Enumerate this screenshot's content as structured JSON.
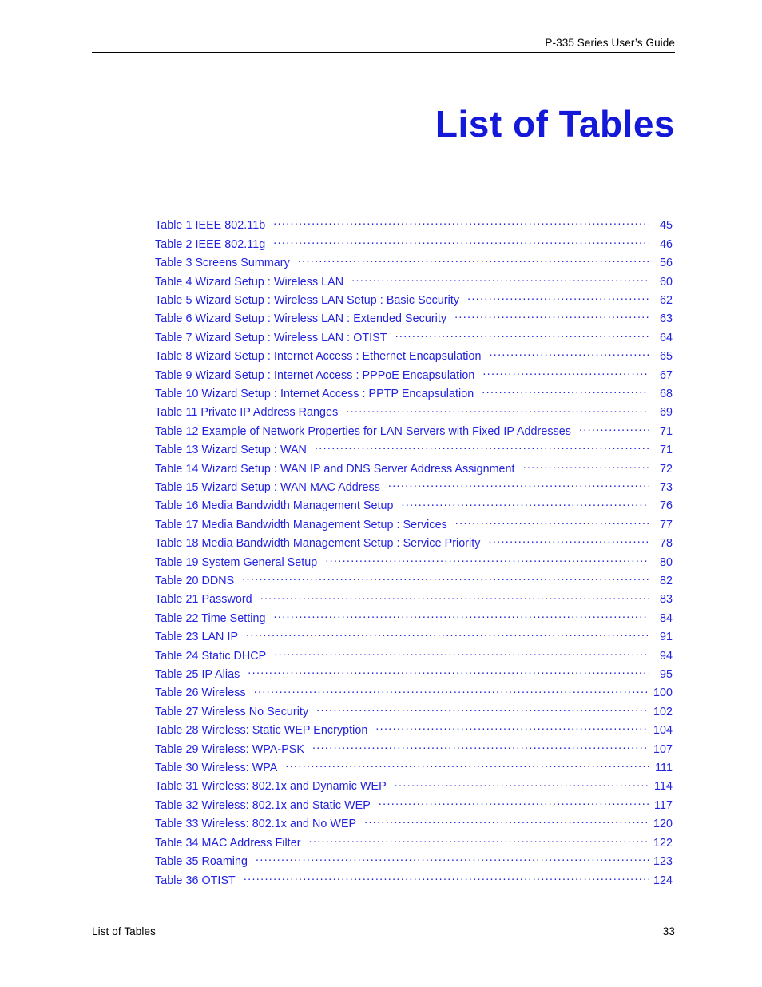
{
  "header": {
    "running_title": "P-335 Series User’s Guide"
  },
  "title": "List of Tables",
  "footer": {
    "section_label": "List of Tables",
    "page_number": "33"
  },
  "colors": {
    "heading_blue": "#1418d8",
    "entry_blue": "#2222e0",
    "rule_black": "#000000",
    "page_background": "#ffffff"
  },
  "toc": {
    "entries": [
      {
        "label": "Table 1 IEEE 802.11b",
        "page": "45"
      },
      {
        "label": "Table 2 IEEE 802.11g",
        "page": "46"
      },
      {
        "label": "Table 3 Screens Summary",
        "page": "56"
      },
      {
        "label": "Table 4 Wizard Setup : Wireless LAN",
        "page": "60"
      },
      {
        "label": "Table 5 Wizard Setup : Wireless LAN Setup : Basic Security",
        "page": "62"
      },
      {
        "label": "Table 6 Wizard Setup : Wireless LAN : Extended Security",
        "page": "63"
      },
      {
        "label": "Table 7 Wizard Setup : Wireless LAN : OTIST",
        "page": "64"
      },
      {
        "label": "Table 8 Wizard Setup : Internet Access : Ethernet Encapsulation",
        "page": "65"
      },
      {
        "label": "Table 9 Wizard Setup : Internet Access : PPPoE Encapsulation",
        "page": "67"
      },
      {
        "label": "Table 10 Wizard Setup : Internet Access : PPTP Encapsulation",
        "page": "68"
      },
      {
        "label": "Table 11 Private IP Address Ranges",
        "page": "69"
      },
      {
        "label": "Table 12 Example of Network Properties for LAN Servers with Fixed IP Addresses",
        "page": "71"
      },
      {
        "label": "Table 13 Wizard Setup : WAN",
        "page": "71"
      },
      {
        "label": "Table 14 Wizard Setup : WAN IP and DNS Server Address Assignment",
        "page": "72"
      },
      {
        "label": "Table 15 Wizard Setup : WAN MAC Address",
        "page": "73"
      },
      {
        "label": "Table 16 Media Bandwidth Management Setup",
        "page": "76"
      },
      {
        "label": "Table 17 Media Bandwidth Management Setup : Services",
        "page": "77"
      },
      {
        "label": "Table 18 Media Bandwidth Management Setup : Service Priority",
        "page": "78"
      },
      {
        "label": "Table 19 System General Setup",
        "page": "80"
      },
      {
        "label": "Table 20 DDNS",
        "page": "82"
      },
      {
        "label": "Table 21 Password",
        "page": "83"
      },
      {
        "label": "Table 22 Time Setting",
        "page": "84"
      },
      {
        "label": "Table 23 LAN IP",
        "page": "91"
      },
      {
        "label": "Table 24 Static DHCP",
        "page": "94"
      },
      {
        "label": "Table 25 IP Alias",
        "page": "95"
      },
      {
        "label": "Table 26 Wireless",
        "page": "100"
      },
      {
        "label": "Table 27 Wireless No Security",
        "page": "102"
      },
      {
        "label": "Table 28 Wireless: Static WEP Encryption",
        "page": "104"
      },
      {
        "label": "Table 29 Wireless: WPA-PSK",
        "page": "107"
      },
      {
        "label": "Table 30 Wireless: WPA",
        "page": "111"
      },
      {
        "label": "Table 31 Wireless: 802.1x and Dynamic WEP",
        "page": "114"
      },
      {
        "label": "Table 32 Wireless: 802.1x and Static WEP",
        "page": "117"
      },
      {
        "label": "Table 33 Wireless: 802.1x and No WEP",
        "page": "120"
      },
      {
        "label": "Table 34 MAC Address Filter",
        "page": "122"
      },
      {
        "label": "Table 35 Roaming",
        "page": "123"
      },
      {
        "label": "Table 36 OTIST",
        "page": "124"
      }
    ]
  }
}
